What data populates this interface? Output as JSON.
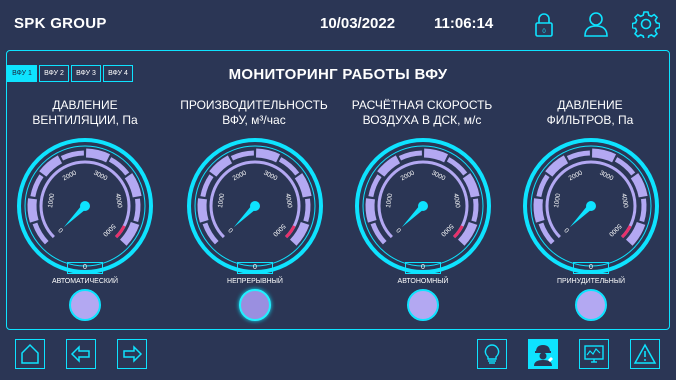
{
  "header": {
    "brand": "SPK GROUP",
    "date": "10/03/2022",
    "time": "11:06:14",
    "lock_badge": "0"
  },
  "tabs": [
    {
      "label": "ВФУ 1",
      "active": true
    },
    {
      "label": "ВФУ 2",
      "active": false
    },
    {
      "label": "ВФУ 3",
      "active": false
    },
    {
      "label": "ВФУ 4",
      "active": false
    }
  ],
  "page_title": "МОНИТОРИНГ РАБОТЫ ВФУ",
  "gauges": [
    {
      "title_line1": "ДАВЛЕНИЕ",
      "title_line2": "ВЕНТИЛЯЦИИ, Па",
      "value": "0",
      "mode_label": "АВТОМАТИЧЕСКИЙ",
      "mode_active": false
    },
    {
      "title_line1": "ПРОИЗВОДИТЕЛЬНОСТЬ",
      "title_line2": "ВФУ, м³/час",
      "value": "0",
      "mode_label": "НЕПРЕРЫВНЫЙ",
      "mode_active": true
    },
    {
      "title_line1": "РАСЧЁТНАЯ СКОРОСТЬ",
      "title_line2": "ВОЗДУХА В ДСК, м/с",
      "value": "0",
      "mode_label": "АВТОНОМНЫЙ",
      "mode_active": false
    },
    {
      "title_line1": "ДАВЛЕНИЕ",
      "title_line2": "ФИЛЬТРОВ, Па",
      "value": "0",
      "mode_label": "ПРИНУДИТЕЛЬНЫЙ",
      "mode_active": false
    }
  ],
  "gauge_scale": [
    "0",
    "1000",
    "2000",
    "3000",
    "4000",
    "5000"
  ],
  "gauge_reading": 0,
  "colors": {
    "accent": "#0ee3ff",
    "background": "#2b3655",
    "scale_fill": "#b3a8f2",
    "redline": "#e8316b"
  },
  "bottom_icons": [
    "home-icon",
    "arrow-left-icon",
    "arrow-right-icon",
    "lightbulb-icon",
    "engineer-icon",
    "monitor-icon",
    "warning-icon"
  ]
}
